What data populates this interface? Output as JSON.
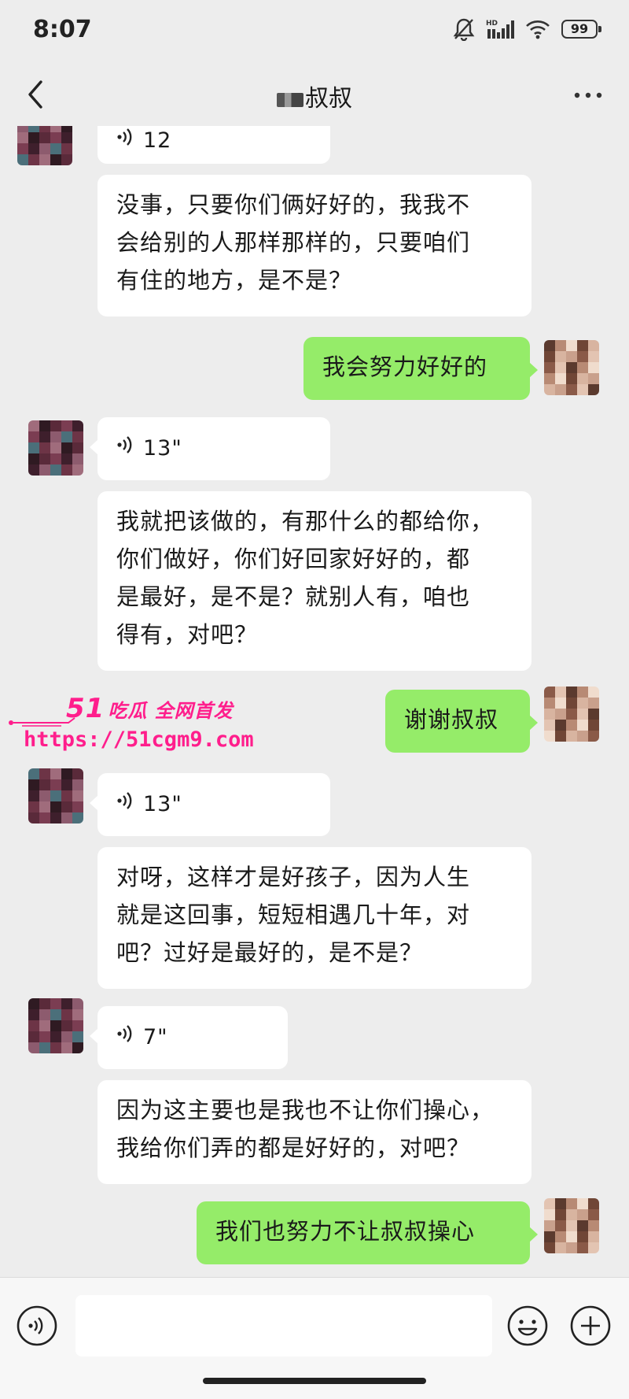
{
  "status_bar": {
    "time": "8:07",
    "battery": "99",
    "network_label": "HD"
  },
  "header": {
    "title": "叔叔"
  },
  "messages": [
    {
      "side": "left",
      "type": "voice",
      "duration": "12"
    },
    {
      "side": "left",
      "type": "text",
      "lines": [
        "没事，只要你们俩好好的，我我不",
        "会给别的人那样那样的，只要咱们",
        "有住的地方，是不是？"
      ]
    },
    {
      "side": "right",
      "type": "text",
      "lines": [
        "我会努力好好的"
      ]
    },
    {
      "side": "left",
      "type": "voice",
      "duration": "13\""
    },
    {
      "side": "left",
      "type": "text",
      "lines": [
        "我就把该做的，有那什么的都给你，",
        "你们做好，你们好回家好好的，都",
        "是最好，是不是？就别人有，咱也",
        "得有，对吧？"
      ]
    },
    {
      "side": "right",
      "type": "text",
      "lines": [
        "谢谢叔叔"
      ]
    },
    {
      "side": "left",
      "type": "voice",
      "duration": "13\""
    },
    {
      "side": "left",
      "type": "text",
      "lines": [
        "对呀，这样才是好孩子，因为人生",
        "就是这回事，短短相遇几十年，对",
        "吧？过好是最好的，是不是？"
      ]
    },
    {
      "side": "left",
      "type": "voice",
      "duration": "7\""
    },
    {
      "side": "left",
      "type": "text",
      "lines": [
        "因为这主要也是我也不让你们操心，",
        "我给你们弄的都是好好的，对吧？"
      ]
    },
    {
      "side": "right",
      "type": "text",
      "lines": [
        "我们也努力不让叔叔操心"
      ]
    }
  ],
  "watermark": {
    "line1_num": "51",
    "line1_text": "吃瓜 全网首发",
    "line2": "https://51cgm9.com"
  },
  "colors": {
    "background": "#ededed",
    "bubble_left": "#ffffff",
    "bubble_right": "#95ec69",
    "watermark": "#ff1e8c"
  },
  "icons": [
    "back-icon",
    "more-icon",
    "voice-wave-icon",
    "emoji-icon",
    "plus-icon",
    "mute-bell-icon",
    "signal-icon",
    "wifi-icon"
  ]
}
